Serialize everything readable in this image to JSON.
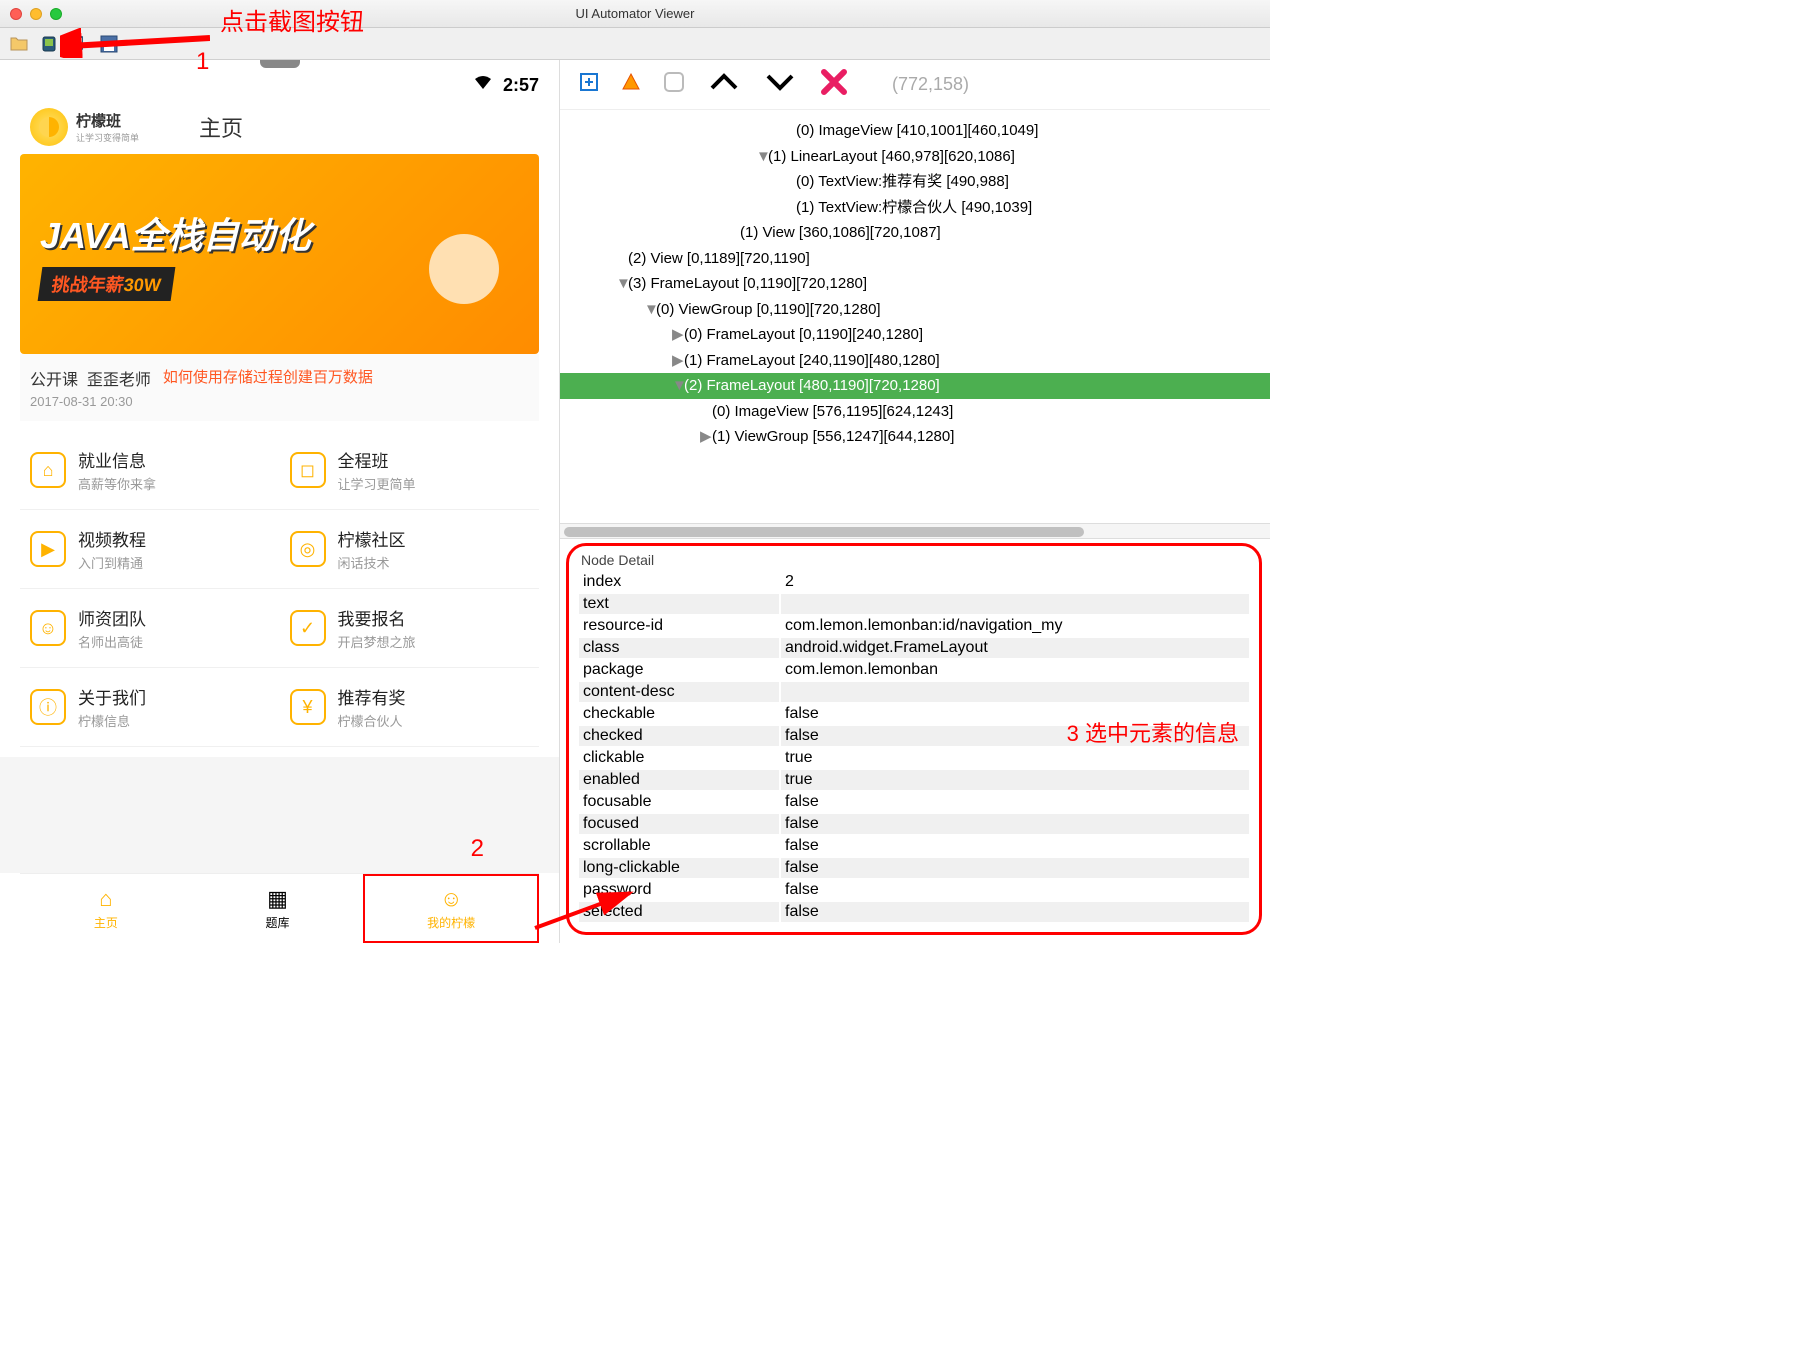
{
  "window_title": "UI Automator Viewer",
  "annotations": {
    "a1_text": "点击截图按钮",
    "a1_num": "1",
    "a2_num": "2",
    "a3_text": "3 选中元素的信息"
  },
  "phone": {
    "time": "2:57",
    "logo_title": "柠檬班",
    "logo_sub": "让学习变得简单",
    "header_main": "主页",
    "banner": {
      "line1": "JAVA全栈自动化",
      "line2_pre": "挑战年薪",
      "line2_strong": "30W"
    },
    "course": {
      "label": "公开课",
      "teacher": "歪歪老师",
      "date": "2017-08-31 20:30",
      "title": "如何使用存储过程创建百万数据"
    },
    "grid": [
      [
        {
          "icon": "⌂",
          "title": "就业信息",
          "sub": "高薪等你来拿"
        },
        {
          "icon": "◻",
          "title": "全程班",
          "sub": "让学习更简单"
        }
      ],
      [
        {
          "icon": "▶",
          "title": "视频教程",
          "sub": "入门到精通"
        },
        {
          "icon": "◎",
          "title": "柠檬社区",
          "sub": "闲话技术"
        }
      ],
      [
        {
          "icon": "☺",
          "title": "师资团队",
          "sub": "名师出高徒"
        },
        {
          "icon": "✓",
          "title": "我要报名",
          "sub": "开启梦想之旅"
        }
      ],
      [
        {
          "icon": "ⓘ",
          "title": "关于我们",
          "sub": "柠檬信息"
        },
        {
          "icon": "¥",
          "title": "推荐有奖",
          "sub": "柠檬合伙人"
        }
      ]
    ],
    "tabs": [
      {
        "icon": "⌂",
        "label": "主页"
      },
      {
        "icon": "▦",
        "label": "题库"
      },
      {
        "icon": "☺",
        "label": "我的柠檬"
      }
    ]
  },
  "right_top": {
    "coords": "(772,158)"
  },
  "tree": [
    {
      "indent": 16,
      "tri": "",
      "text": "(0) ImageView [410,1001][460,1049]",
      "sel": false
    },
    {
      "indent": 14,
      "tri": "▼",
      "text": "(1) LinearLayout [460,978][620,1086]",
      "sel": false
    },
    {
      "indent": 16,
      "tri": "",
      "text": "(0) TextView:推荐有奖 [490,988]",
      "sel": false
    },
    {
      "indent": 16,
      "tri": "",
      "text": "(1) TextView:柠檬合伙人 [490,1039]",
      "sel": false
    },
    {
      "indent": 12,
      "tri": "",
      "text": "(1) View [360,1086][720,1087]",
      "sel": false
    },
    {
      "indent": 4,
      "tri": "",
      "text": "(2) View [0,1189][720,1190]",
      "sel": false
    },
    {
      "indent": 4,
      "tri": "▼",
      "text": "(3) FrameLayout [0,1190][720,1280]",
      "sel": false
    },
    {
      "indent": 6,
      "tri": "▼",
      "text": "(0) ViewGroup [0,1190][720,1280]",
      "sel": false
    },
    {
      "indent": 8,
      "tri": "▶",
      "text": "(0) FrameLayout [0,1190][240,1280]",
      "sel": false
    },
    {
      "indent": 8,
      "tri": "▶",
      "text": "(1) FrameLayout [240,1190][480,1280]",
      "sel": false
    },
    {
      "indent": 8,
      "tri": "▼",
      "text": "(2) FrameLayout [480,1190][720,1280]",
      "sel": true
    },
    {
      "indent": 10,
      "tri": "",
      "text": "(0) ImageView [576,1195][624,1243]",
      "sel": false
    },
    {
      "indent": 10,
      "tri": "▶",
      "text": "(1) ViewGroup [556,1247][644,1280]",
      "sel": false
    }
  ],
  "node_detail": {
    "title": "Node Detail",
    "rows": [
      {
        "k": "index",
        "v": "2"
      },
      {
        "k": "text",
        "v": ""
      },
      {
        "k": "resource-id",
        "v": "com.lemon.lemonban:id/navigation_my"
      },
      {
        "k": "class",
        "v": "android.widget.FrameLayout"
      },
      {
        "k": "package",
        "v": "com.lemon.lemonban"
      },
      {
        "k": "content-desc",
        "v": ""
      },
      {
        "k": "checkable",
        "v": "false"
      },
      {
        "k": "checked",
        "v": "false"
      },
      {
        "k": "clickable",
        "v": "true"
      },
      {
        "k": "enabled",
        "v": "true"
      },
      {
        "k": "focusable",
        "v": "false"
      },
      {
        "k": "focused",
        "v": "false"
      },
      {
        "k": "scrollable",
        "v": "false"
      },
      {
        "k": "long-clickable",
        "v": "false"
      },
      {
        "k": "password",
        "v": "false"
      },
      {
        "k": "selected",
        "v": "false"
      }
    ]
  }
}
